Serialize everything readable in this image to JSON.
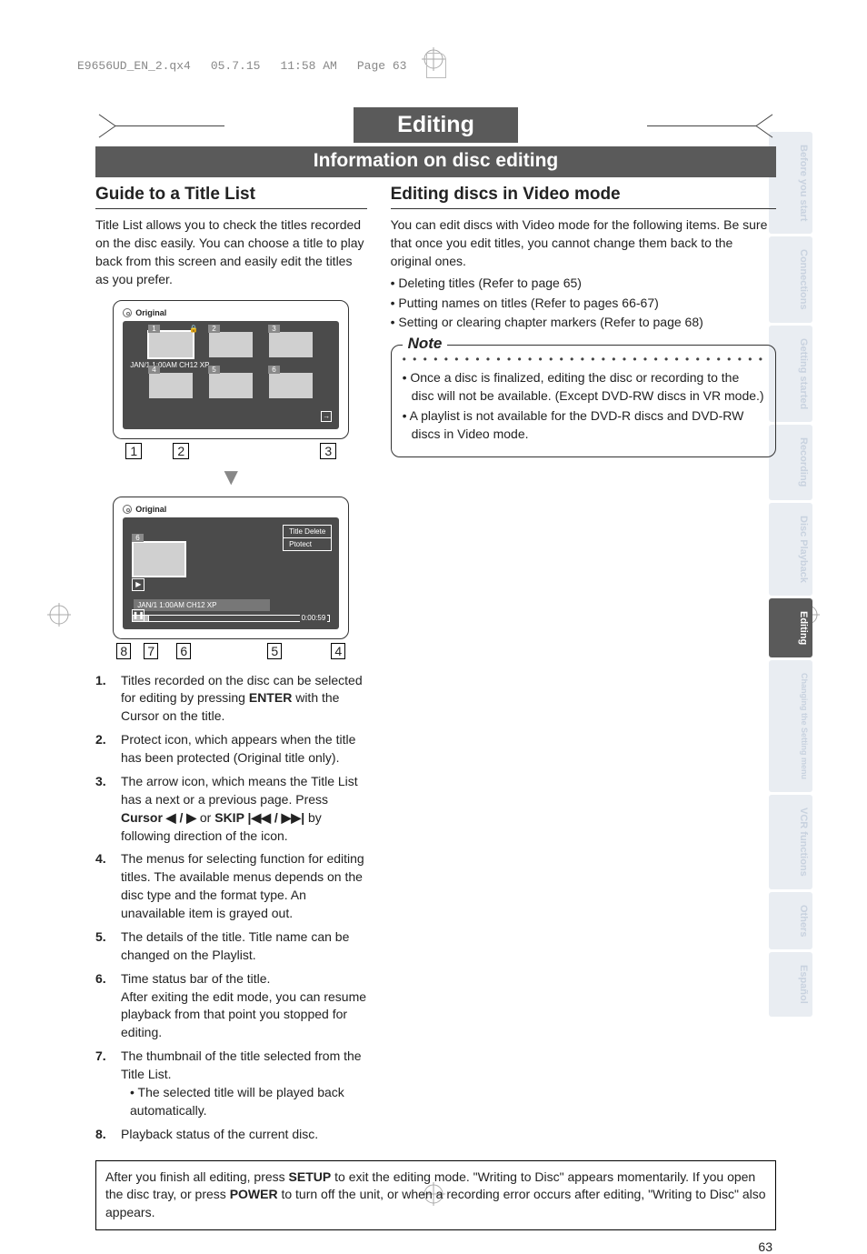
{
  "file_header": {
    "filename": "E9656UD_EN_2.qx4",
    "date": "05.7.15",
    "time": "11:58 AM",
    "page_mark": "Page 63"
  },
  "title": "Editing",
  "section_bar": "Information on disc editing",
  "left": {
    "heading": "Guide to a Title List",
    "intro": "Title List allows you to check the titles recorded on the disc easily. You can choose a title to play back from this screen and easily edit the titles as you prefer.",
    "tv1": {
      "mode_label": "Original",
      "thumbs": [
        "1",
        "2",
        "3",
        "4",
        "5",
        "6"
      ],
      "caption": "JAN/1 1:00AM CH12 XP"
    },
    "callouts1": [
      "1",
      "2",
      "3"
    ],
    "tv2": {
      "mode_label": "Original",
      "thumb_num": "6",
      "menu": {
        "item1": "Title Delete",
        "item2": "Ptotect"
      },
      "title_strip": "JAN/1 1:00AM CH12 XP",
      "time": "0:00:59"
    },
    "callouts2": [
      "8",
      "7",
      "6",
      "5",
      "4"
    ],
    "list": {
      "i1": {
        "n": "1.",
        "t": "Titles recorded on the disc can be selected for editing by pressing ENTER with the Cursor on the title."
      },
      "i2": {
        "n": "2.",
        "t": "Protect icon, which appears when the title has been protected (Original title only)."
      },
      "i3": {
        "n": "3.",
        "t_a": "The arrow icon, which means the Title List has a next or a previous page. Press ",
        "t_b": "Cursor ◀ / ▶",
        "t_c": " or ",
        "t_d": "SKIP |◀◀ / ▶▶|",
        "t_e": " by following direction of the icon."
      },
      "i4": {
        "n": "4.",
        "t": "The menus for selecting function for editing titles. The available menus depends on the disc type and the format type. An unavailable item is grayed out."
      },
      "i5": {
        "n": "5.",
        "t": "The details of the title. Title name can be changed on the Playlist."
      },
      "i6": {
        "n": "6.",
        "t": "Time status bar of the title.\nAfter exiting the edit mode, you can resume playback from that point you stopped for editing."
      },
      "i7": {
        "n": "7.",
        "t": "The thumbnail of the title selected from the Title List.",
        "sub": "• The selected title will be played back automatically."
      },
      "i8": {
        "n": "8.",
        "t": "Playback status of the current disc."
      }
    }
  },
  "right": {
    "heading": "Editing discs in Video mode",
    "intro": "You can edit discs with Video mode for the following items. Be sure that once you edit titles, you cannot change them back to the original ones.",
    "bullets": {
      "b1": "• Deleting titles (Refer to page 65)",
      "b2": "• Putting names on titles (Refer to pages 66-67)",
      "b3": "• Setting or clearing chapter markers (Refer to page 68)"
    },
    "note": {
      "title": "Note",
      "n1": "• Once a disc is finalized, editing the disc or recording to the disc will not be available. (Except DVD-RW discs in VR mode.)",
      "n2": "• A playlist is not available for the DVD-R discs and DVD-RW discs in Video mode."
    }
  },
  "footer": {
    "text_a": "After you finish all editing, press ",
    "text_b": "SETUP",
    "text_c": " to exit the editing mode. \"Writing to Disc\" appears momentarily. If you open the disc tray, or press ",
    "text_d": "POWER",
    "text_e": " to turn off the unit, or when a recording error occurs after editing, \"Writing to Disc\" also appears."
  },
  "page_number": "63",
  "tabs": {
    "t1": "Before you start",
    "t2": "Connections",
    "t3": "Getting started",
    "t4": "Recording",
    "t5": "Disc Playback",
    "t6": "Editing",
    "t7": "Changing the Setting menu",
    "t8": "VCR functions",
    "t9": "Others",
    "t10": "Español"
  }
}
